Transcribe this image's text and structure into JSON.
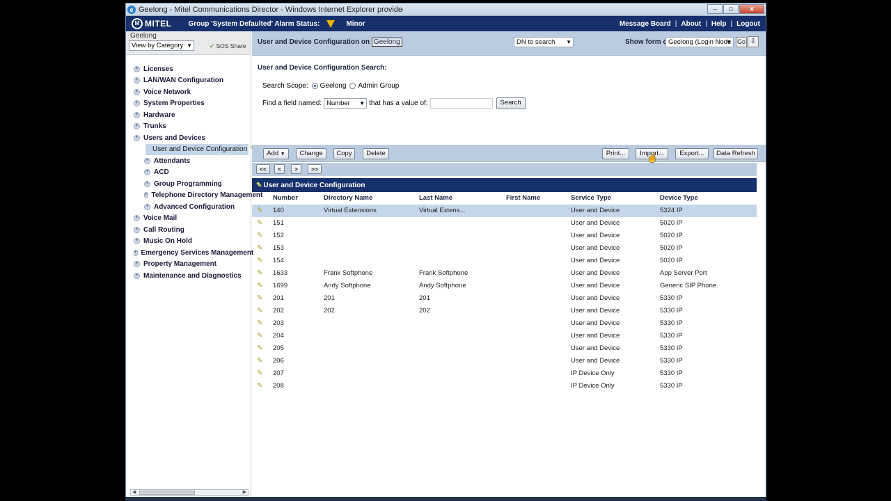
{
  "window": {
    "title": "Geelong - Mitel Communications Director - Windows Internet Explorer provided by Connect Tel"
  },
  "header": {
    "logo": "MITEL",
    "alarm_label": "Group 'System Defaulted' Alarm Status:",
    "alarm_level": "Minor",
    "alarm_color": "#f2b200",
    "links": [
      "Message Board",
      "About",
      "Help",
      "Logout"
    ]
  },
  "left": {
    "site": "Geelong",
    "view_select": "View by Category",
    "sos": "SOS Share",
    "tree": [
      {
        "label": "Licenses",
        "level": 0
      },
      {
        "label": "LAN/WAN Configuration",
        "level": 0
      },
      {
        "label": "Voice Network",
        "level": 0
      },
      {
        "label": "System Properties",
        "level": 0
      },
      {
        "label": "Hardware",
        "level": 0
      },
      {
        "label": "Trunks",
        "level": 0
      },
      {
        "label": "Users and Devices",
        "level": 0
      },
      {
        "label": "User and Device Configuration",
        "level": 1,
        "selected": true
      },
      {
        "label": "Attendants",
        "level": 1
      },
      {
        "label": "ACD",
        "level": 1
      },
      {
        "label": "Group Programming",
        "level": 1
      },
      {
        "label": "Telephone Directory Management",
        "level": 1
      },
      {
        "label": "Advanced Configuration",
        "level": 1
      },
      {
        "label": "Voice Mail",
        "level": 0
      },
      {
        "label": "Call Routing",
        "level": 0
      },
      {
        "label": "Music On Hold",
        "level": 0
      },
      {
        "label": "Emergency Services Management",
        "level": 0
      },
      {
        "label": "Property Management",
        "level": 0
      },
      {
        "label": "Maintenance and Diagnostics",
        "level": 0
      }
    ]
  },
  "formbar": {
    "title": "User and Device Configuration on",
    "site": "Geelong",
    "dn_select": "DN to search",
    "show_label": "Show form on",
    "show_select": "Geelong (Login Node",
    "go": "Go"
  },
  "search": {
    "title": "User and Device Configuration  Search:",
    "scope_label": "Search Scope:",
    "scope_options": [
      "Geelong",
      "Admin Group"
    ],
    "find_label": "Find a field named:",
    "field_select": "Number",
    "value_label": "that has a value of:",
    "value": "",
    "button": "Search"
  },
  "toolbar": {
    "add": "Add",
    "change": "Change",
    "copy": "Copy",
    "delete": "Delete",
    "print": "Print...",
    "import": "Import...",
    "export": "Export...",
    "refresh": "Data Refresh"
  },
  "pager": {
    "first": "<<",
    "prev": "<",
    "next": ">",
    "last": ">>"
  },
  "grid": {
    "title": "User and Device Configuration",
    "columns": [
      "Number",
      "Directory Name",
      "Last Name",
      "First Name",
      "Service Type",
      "Device Type"
    ],
    "rows": [
      [
        "140",
        "Virtual Extensions",
        "Virtual Extens...",
        "",
        "User and Device",
        "5324 IP"
      ],
      [
        "151",
        "",
        "",
        "",
        "User and Device",
        "5020 IP"
      ],
      [
        "152",
        "",
        "",
        "",
        "User and Device",
        "5020 IP"
      ],
      [
        "153",
        "",
        "",
        "",
        "User and Device",
        "5020 IP"
      ],
      [
        "154",
        "",
        "",
        "",
        "User and Device",
        "5020 IP"
      ],
      [
        "1633",
        "Frank Softphone",
        "Frank Softphone",
        "",
        "User and Device",
        "App Server Port"
      ],
      [
        "1699",
        "Andy Softphone",
        "Andy Softphone",
        "",
        "User and Device",
        "Generic SIP Phone"
      ],
      [
        "201",
        "201",
        "201",
        "",
        "User and Device",
        "5330 IP"
      ],
      [
        "202",
        "202",
        "202",
        "",
        "User and Device",
        "5330 IP"
      ],
      [
        "203",
        "",
        "",
        "",
        "User and Device",
        "5330 IP"
      ],
      [
        "204",
        "",
        "",
        "",
        "User and Device",
        "5330 IP"
      ],
      [
        "205",
        "",
        "",
        "",
        "User and Device",
        "5330 IP"
      ],
      [
        "206",
        "",
        "",
        "",
        "User and Device",
        "5330 IP"
      ],
      [
        "207",
        "",
        "",
        "",
        "IP Device Only",
        "5330 IP"
      ],
      [
        "208",
        "",
        "",
        "",
        "IP Device Only",
        "5330 IP"
      ]
    ]
  }
}
